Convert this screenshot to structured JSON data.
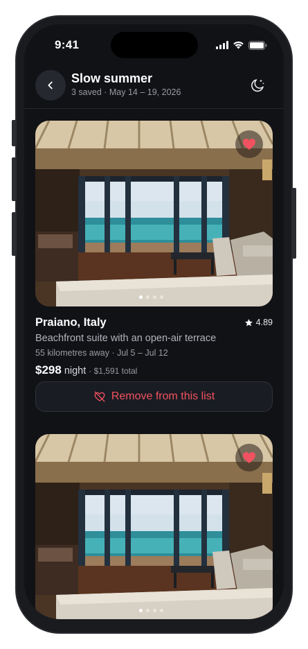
{
  "status_bar": {
    "time": "9:41"
  },
  "header": {
    "title": "Slow summer",
    "subtitle": "3 saved · May 14 – 19, 2026"
  },
  "listings": [
    {
      "location": "Praiano, Italy",
      "rating": "4.89",
      "description": "Beachfront suite with an open-air terrace",
      "meta": "55 kilometres away · Jul 5 – Jul 12",
      "price": "$298",
      "price_unit": "night",
      "total": "· $1,591 total",
      "remove_label": "Remove from this list",
      "photo_count": 4,
      "active_photo": 0
    },
    {
      "photo_count": 4,
      "active_photo": 0
    }
  ],
  "colors": {
    "accent": "#f0525f",
    "background": "#111216"
  },
  "icons": [
    "back-chevron-icon",
    "moon-icon",
    "heart-icon",
    "star-icon",
    "heart-off-icon",
    "signal-icon",
    "wifi-icon",
    "battery-icon"
  ]
}
